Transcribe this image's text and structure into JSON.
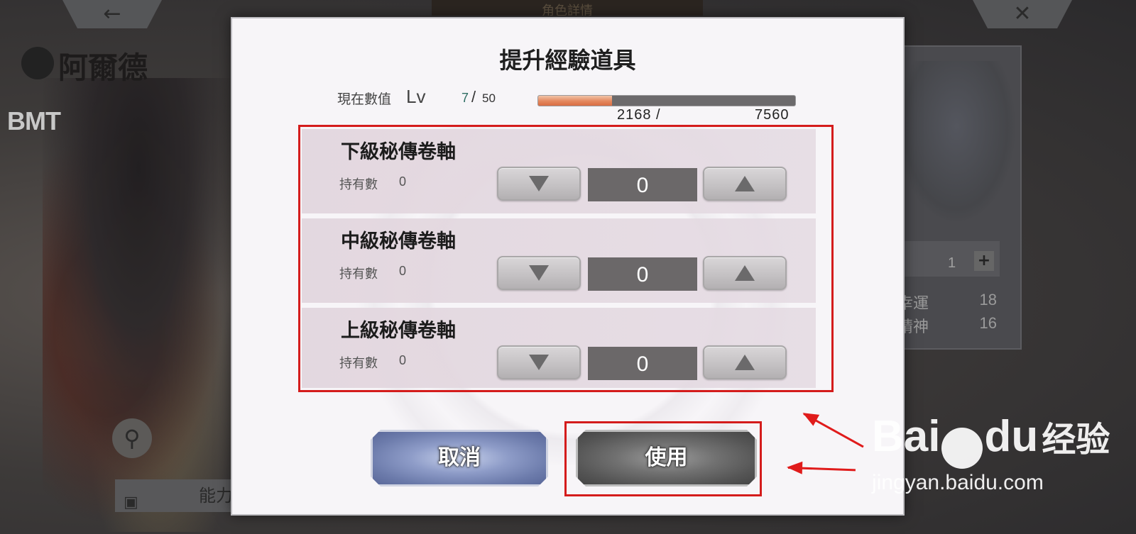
{
  "background": {
    "top_title": "角色詳情",
    "character_name": "阿爾德",
    "logo_text": "BMT",
    "bottom_tab_label": "能力",
    "back_icon": "←",
    "close_icon": "✕",
    "stat_count": "1",
    "stats": [
      {
        "label": "幸運",
        "value": "18"
      },
      {
        "label": "精神",
        "value": "16"
      }
    ]
  },
  "dialog": {
    "title": "提升經驗道具",
    "current_value_label": "現在數值",
    "level_label": "Lv",
    "level_current": "7",
    "level_separator": "/",
    "level_max": "50",
    "exp_current": "2168 /",
    "exp_max": "7560",
    "exp_progress_fraction": 0.287,
    "items": [
      {
        "name": "下級秘傳卷軸",
        "owned_label": "持有數",
        "owned": "0",
        "quantity": "0"
      },
      {
        "name": "中級秘傳卷軸",
        "owned_label": "持有數",
        "owned": "0",
        "quantity": "0"
      },
      {
        "name": "上級秘傳卷軸",
        "owned_label": "持有數",
        "owned": "0",
        "quantity": "0"
      }
    ],
    "cancel_label": "取消",
    "use_label": "使用"
  },
  "watermark": {
    "brand_left": "Bai",
    "brand_right": "du",
    "brand_cn": "经验",
    "url": "jingyan.baidu.com"
  },
  "colors": {
    "annotation_red": "#d41c1c",
    "exp_fill": "#e4875e",
    "quantity_box": "#6b6869"
  }
}
